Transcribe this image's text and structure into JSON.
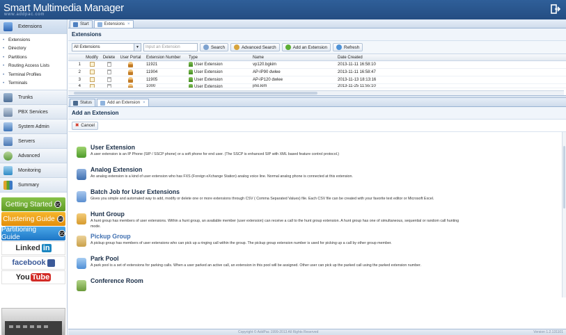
{
  "app": {
    "title": "Smart Multimedia Manager",
    "subtitle": "www.addpac.com"
  },
  "sidebar": {
    "extensions_label": "Extensions",
    "sub_items": [
      "Extensions",
      "Directory",
      "Partitions",
      "Routing Access Lists",
      "Terminal Profiles",
      "Terminals"
    ],
    "items": [
      "Trunks",
      "PBX Services",
      "System Admin",
      "Servers",
      "Advanced",
      "Monitoring",
      "Summary"
    ],
    "promos": [
      "Getting Started",
      "Clustering Guide",
      "Partitioning Guide"
    ],
    "go_label": "GO",
    "social": [
      "Linked",
      "in",
      "facebook",
      "You",
      "Tube"
    ]
  },
  "top_tabs": [
    "Start",
    "Extensions"
  ],
  "extensions_panel": {
    "title": "Extensions",
    "filter_value": "All Extensions",
    "search_placeholder": "Input an Extension",
    "buttons": [
      "Search",
      "Advanced Search",
      "Add an Extension",
      "Refresh"
    ],
    "columns": [
      "",
      "Modify",
      "Delete",
      "User Portal",
      "Extension Number",
      "Type",
      "Name",
      "Date Created"
    ],
    "rows": [
      {
        "n": "1",
        "ext": "11921",
        "type": "User Extension",
        "name": "vp120.bgkim",
        "date": "2013-11-11 16:58:10"
      },
      {
        "n": "2",
        "ext": "11904",
        "type": "User Extension",
        "name": "AP-IP90 dwlee",
        "date": "2013-11-11 16:58:47"
      },
      {
        "n": "3",
        "ext": "11905",
        "type": "User Extension",
        "name": "AP-IP120 dwlee",
        "date": "2013-11-13 18:13:16"
      },
      {
        "n": "4",
        "ext": "1000",
        "type": "User Extension",
        "name": "jino.kim",
        "date": "2013-11-25 11:55:10"
      }
    ]
  },
  "bottom_tabs": [
    "Status",
    "Add an Extension"
  ],
  "add_panel": {
    "title": "Add an Extension",
    "cancel_label": "Cancel",
    "options": [
      {
        "title": "User Extension",
        "desc": "A user extension is an IP Phone (SIP / SSCP phone) or a soft phone for end user. (The SSCP is enhanced SIP with XML based feature control protocol.)",
        "color": "#4c9a2a"
      },
      {
        "title": "Analog Extension",
        "desc": "An analog extension is a kind of user extension who has FXS (Foreign eXchange Station) analog voice line. Normal analog phone is connected at this extension.",
        "color": "#3f6fb0"
      },
      {
        "title": "Batch Job for User Extensions",
        "desc": "Gives you simple and automated way to add, modify or delete one or more extensions through CSV ( Comma Separated Values) file. Each CSV file can be created with your favorite text editor or Microsoft Excel.",
        "color": "#5c8fd0"
      },
      {
        "title": "Hunt Group",
        "desc": "A hunt group has members of user extensions. Within a hunt group, an available member (user extension) can receive a call to the hunt group extension. A hunt group has one of simultaneous, sequential or random call hunting mode.",
        "color": "#d69a2d"
      },
      {
        "title": "Pickup Group",
        "desc": "A pickup group has members of user extensions who can pick up a ringing call within the group. The pickup group extension number is used for picking up a call by other group member.",
        "color": "#c9a04a"
      },
      {
        "title": "Park Pool",
        "desc": "A park pool is a set of extensions for parking calls. When a user parked an active call, an extension in this pool will be assigned. Other user can pick up the parked call using the parked extension number.",
        "color": "#4f8fd6"
      },
      {
        "title": "Conference Room",
        "desc": "",
        "color": "#6b9a3a"
      }
    ]
  },
  "footer": {
    "copyright": "Copyright © AddPac 1999-2013 All Rights Reserved",
    "version": "Version 1.2.131101"
  }
}
